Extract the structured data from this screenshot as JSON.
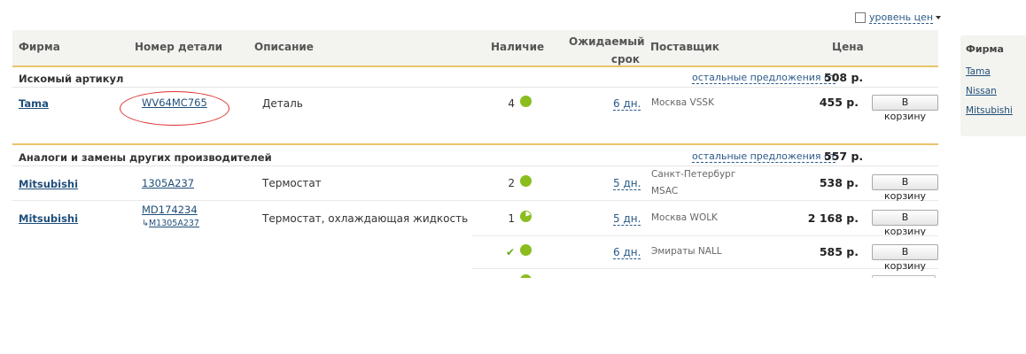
{
  "price_level": {
    "label": "уровень цен"
  },
  "headers": {
    "brand": "Фирма",
    "part_number": "Номер детали",
    "description": "Описание",
    "availability": "Наличие",
    "expected_1": "Ожидаемый",
    "expected_2": "срок",
    "supplier": "Поставщик",
    "price": "Цена"
  },
  "searched": {
    "label": "Искомый артикул",
    "other_offers": "остальные предложения от",
    "other_price": "508 р.",
    "rows": [
      {
        "brand": "Tama",
        "part": "WV64MC765",
        "description": "Деталь",
        "qty": "4",
        "days": "6 дн.",
        "supplier": "Москва VSSK",
        "price": "455 р.",
        "button": "В корзину"
      }
    ]
  },
  "analogs": {
    "label": "Аналоги и замены других производителей",
    "other_offers": "остальные предложения от",
    "other_price": "557 р.",
    "rows": [
      {
        "brand": "Mitsubishi",
        "part": "1305A237",
        "description": "Термостат",
        "qty": "2",
        "days": "5 дн.",
        "supplier_1": "Санкт-Петербург",
        "supplier_2": "MSAC",
        "price": "538 р.",
        "button": "В корзину"
      },
      {
        "brand": "Mitsubishi",
        "part": "MD174234",
        "subpart": "M1305A237",
        "description": "Термостат, охлаждающая жидкость",
        "qty": "1",
        "days": "5 дн.",
        "supplier": "Москва WOLK",
        "price": "2 168 р.",
        "button": "В корзину"
      },
      {
        "days": "6 дн.",
        "supplier": "Эмираты NALL",
        "price": "585 р.",
        "button": "В корзину"
      }
    ]
  },
  "filter": {
    "title": "Фирма",
    "items": [
      "Tama",
      "Nissan",
      "Mitsubishi"
    ]
  },
  "colors": {
    "accent_line": "#e9c36a",
    "status_green": "#8bbd1f",
    "link": "#1f4e79",
    "annotation": "#dd3333"
  },
  "icons": [
    "checkbox-icon",
    "caret-down-icon",
    "availability-dot-icon",
    "availability-pie-icon",
    "check-icon",
    "sub-arrow-icon"
  ]
}
